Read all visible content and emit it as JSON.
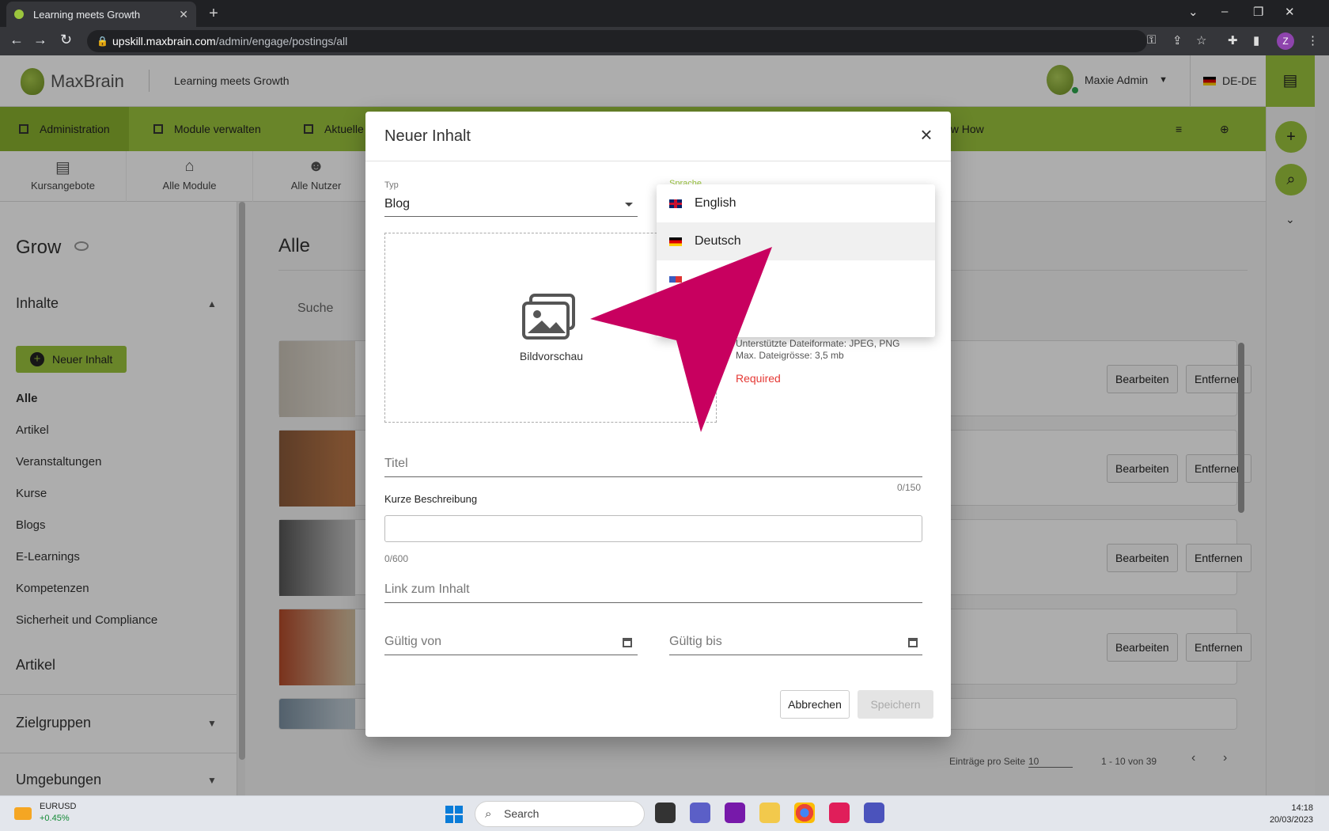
{
  "browser": {
    "tab_title": "Learning meets Growth",
    "url_host": "upskill.maxbrain.com",
    "url_path": "/admin/engage/postings/all",
    "profile_initial": "Z"
  },
  "header": {
    "brand": "MaxBrain",
    "tagline": "Learning meets Growth",
    "user_name": "Maxie Admin",
    "language": "DE-DE"
  },
  "greennav": {
    "items": [
      "Administration",
      "Module verwalten",
      "Aktuelle",
      "ow How"
    ]
  },
  "subnav": {
    "items": [
      "Kursangebote",
      "Alle Module",
      "Alle Nutzer"
    ]
  },
  "sidebar": {
    "title": "Grow",
    "section_inhalte": "Inhalte",
    "new_button": "Neuer Inhalt",
    "items": [
      "Alle",
      "Artikel",
      "Veranstaltungen",
      "Kurse",
      "Blogs",
      "E-Learnings",
      "Kompetenzen",
      "Sicherheit und Compliance"
    ],
    "section_artikel": "Artikel",
    "section_zielgruppen": "Zielgruppen",
    "section_umgebungen": "Umgebungen"
  },
  "main": {
    "title": "Alle",
    "search_placeholder": "Suche",
    "edit_label": "Bearbeiten",
    "remove_label": "Entfernen",
    "per_page_label": "Einträge pro Seite",
    "per_page_value": "10",
    "range": "1 - 10 von 39"
  },
  "dialog": {
    "title": "Neuer Inhalt",
    "type_label": "Typ",
    "type_value": "Blog",
    "image_label": "Bildvorschau",
    "hint_formats": "Unterstützte Dateiformate: JPEG, PNG",
    "hint_size": "Max. Dateigrösse: 3,5 mb",
    "required": "Required",
    "title_placeholder": "Titel",
    "title_counter": "0/150",
    "short_desc_label": "Kurze Beschreibung",
    "short_desc_counter": "0/600",
    "link_placeholder": "Link zum Inhalt",
    "valid_from": "Gültig von",
    "valid_to": "Gültig bis",
    "cancel": "Abbrechen",
    "save": "Speichern"
  },
  "language_dropdown": {
    "label": "Sprache",
    "options": [
      "English",
      "Deutsch"
    ],
    "highlighted": "Deutsch"
  },
  "annotation": {
    "arrow_color": "#c8005f"
  },
  "taskbar": {
    "ticker_symbol": "EURUSD",
    "ticker_change": "+0.45%",
    "search": "Search",
    "time": "14:18",
    "date": "20/03/2023"
  },
  "colors": {
    "accent": "#9bc53d",
    "required": "#e53935"
  }
}
